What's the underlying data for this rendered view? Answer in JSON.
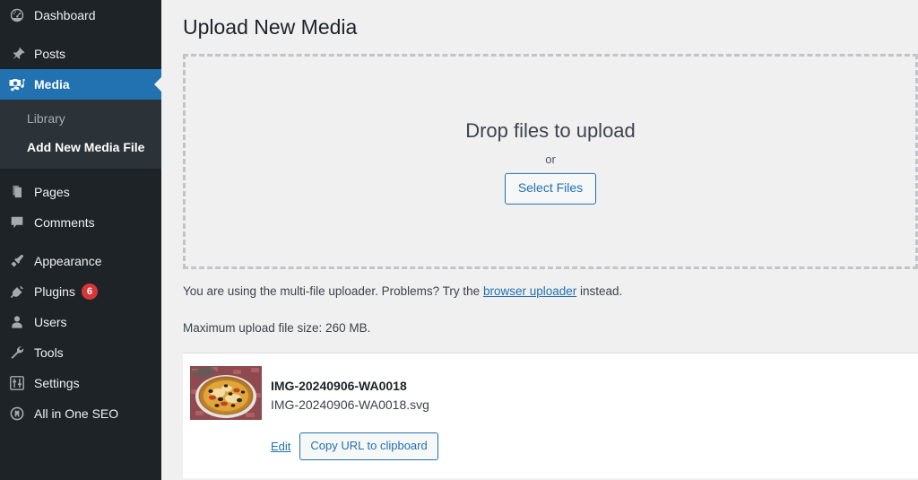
{
  "sidebar": {
    "items": [
      {
        "label": "Dashboard",
        "icon": "dashboard-icon",
        "current": false
      },
      {
        "label": "Posts",
        "icon": "pin-icon",
        "current": false
      },
      {
        "label": "Media",
        "icon": "media-camera-icon",
        "current": true
      },
      {
        "label": "Pages",
        "icon": "pages-icon",
        "current": false
      },
      {
        "label": "Comments",
        "icon": "comment-bubble-icon",
        "current": false
      },
      {
        "label": "Appearance",
        "icon": "paintbrush-icon",
        "current": false
      },
      {
        "label": "Plugins",
        "icon": "plug-icon",
        "current": false,
        "badge": "6"
      },
      {
        "label": "Users",
        "icon": "user-icon",
        "current": false
      },
      {
        "label": "Tools",
        "icon": "wrench-icon",
        "current": false
      },
      {
        "label": "Settings",
        "icon": "sliders-icon",
        "current": false
      },
      {
        "label": "All in One SEO",
        "icon": "aioseo-icon",
        "current": false
      }
    ],
    "submenu": [
      {
        "label": "Library",
        "active": false
      },
      {
        "label": "Add New Media File",
        "active": true
      }
    ],
    "badge_color": "#d63638",
    "current_color": "#2271b1"
  },
  "main": {
    "page_title": "Upload New Media",
    "dropzone": {
      "drop_title": "Drop files to upload",
      "or_text": "or",
      "select_files_label": "Select Files"
    },
    "notes": {
      "uploader_note_before": "You are using the multi-file uploader. Problems? Try the ",
      "uploader_link": "browser uploader",
      "uploader_note_after": " instead.",
      "max_size": "Maximum upload file size: 260 MB."
    },
    "uploaded": {
      "title": "IMG-20240906-WA0018",
      "filename": "IMG-20240906-WA0018.svg",
      "edit_label": "Edit",
      "copy_label": "Copy URL to clipboard",
      "thumbnail_alt": "pizza-photo-thumbnail"
    }
  }
}
